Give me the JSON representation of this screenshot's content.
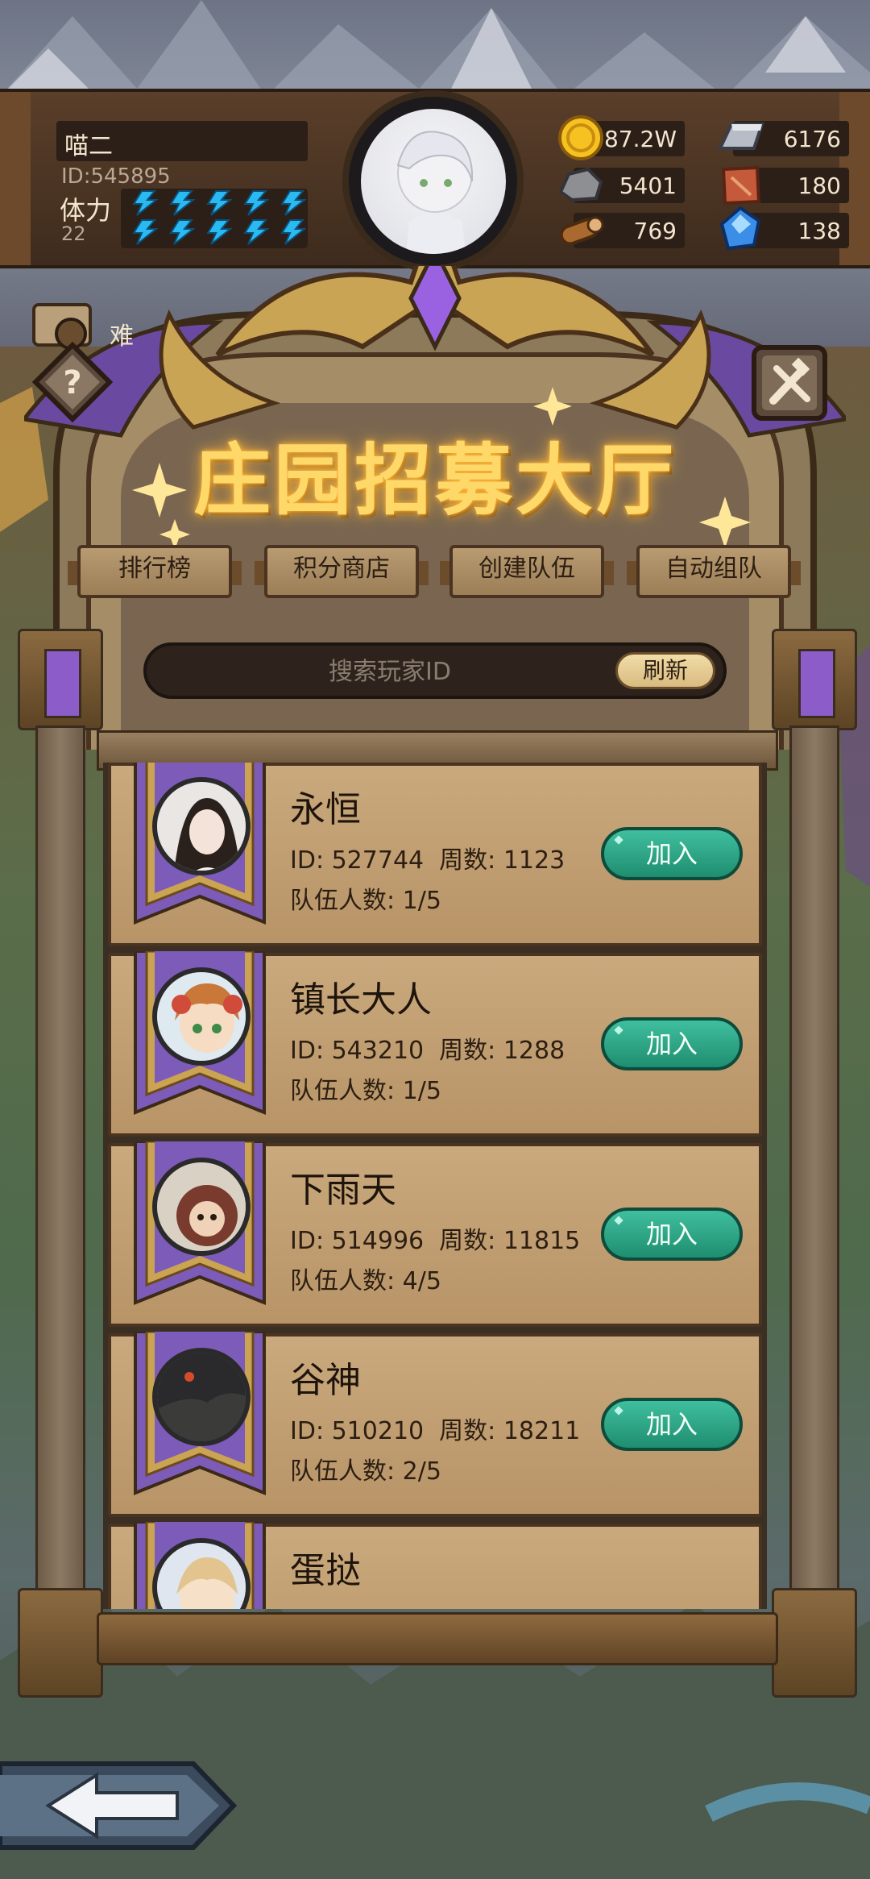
{
  "player": {
    "name": "喵二",
    "id_text": "ID:545895",
    "stamina_label": "体力",
    "stamina_value": "22",
    "stamina_bolts": 10
  },
  "resources": [
    {
      "icon": "gold-coin-icon",
      "value": "87.2W"
    },
    {
      "icon": "iron-ingot-icon",
      "value": "6176"
    },
    {
      "icon": "stone-icon",
      "value": "5401"
    },
    {
      "icon": "leather-icon",
      "value": "180"
    },
    {
      "icon": "wood-log-icon",
      "value": "769"
    },
    {
      "icon": "blue-crystal-icon",
      "value": "138"
    }
  ],
  "side_tab": {
    "label": "难"
  },
  "hall": {
    "title": "庄园招募大厅",
    "tabs": [
      "排行榜",
      "积分商店",
      "创建队伍",
      "自动组队"
    ],
    "search_placeholder": "搜索玩家ID",
    "refresh_label": "刷新"
  },
  "teams": [
    {
      "name": "永恒",
      "meta": "ID: 527744  周数: 1123",
      "members": "队伍人数: 1/5",
      "join": "加入"
    },
    {
      "name": "镇长大人",
      "meta": "ID: 543210  周数: 1288",
      "members": "队伍人数: 1/5",
      "join": "加入"
    },
    {
      "name": "下雨天",
      "meta": "ID: 514996  周数: 11815",
      "members": "队伍人数: 4/5",
      "join": "加入"
    },
    {
      "name": "谷神",
      "meta": "ID: 510210  周数: 18211",
      "members": "队伍人数: 2/5",
      "join": "加入"
    },
    {
      "name": "蛋挞",
      "meta": "",
      "members": "",
      "join": ""
    }
  ],
  "colors": {
    "title_gold": "#ffd86a",
    "join_green": "#2fa583",
    "banner_purple": "#7d5bb8",
    "panel_tan": "#c9a97d"
  }
}
